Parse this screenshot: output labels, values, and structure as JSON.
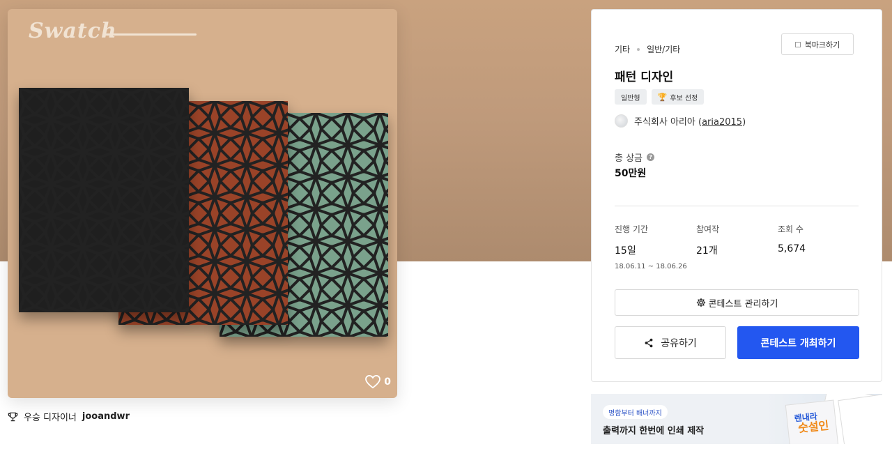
{
  "hero": {
    "brand": "Swatch",
    "like_count": "0",
    "winner_prefix": "우승 디자이너",
    "winner_name": "jooandwr"
  },
  "info": {
    "breadcrumb": [
      "기타",
      "일반/기타"
    ],
    "bookmark_label": "북마크하기",
    "title": "패턴 디자인",
    "tags": [
      "일반형",
      "후보 선정"
    ],
    "host_name": "주식회사 아리아",
    "host_handle": "aria2015",
    "prize_label": "총 상금",
    "prize_value": "50만원",
    "stats": {
      "period_label": "진행 기간",
      "period_value": "15일",
      "period_dates": "18.06.11 ~ 18.06.26",
      "entries_label": "참여작",
      "entries_value": "21개",
      "views_label": "조회 수",
      "views_value": "5,674"
    },
    "manage_button": "콘테스트 관리하기",
    "share_button": "공유하기",
    "host_button": "콘테스트 개최하기"
  },
  "banner": {
    "pill": "명함부터 배너까지",
    "headline": "출력까지 한번에 인쇄 제작",
    "promo_line1": "렌내라",
    "promo_line2": "숫설인"
  },
  "colors": {
    "accent": "#2357f0",
    "panel_black": "#1f1f1f",
    "panel_red": "#9a4328",
    "panel_green": "#7aa28c",
    "hero_bg": "#d6b08d"
  }
}
